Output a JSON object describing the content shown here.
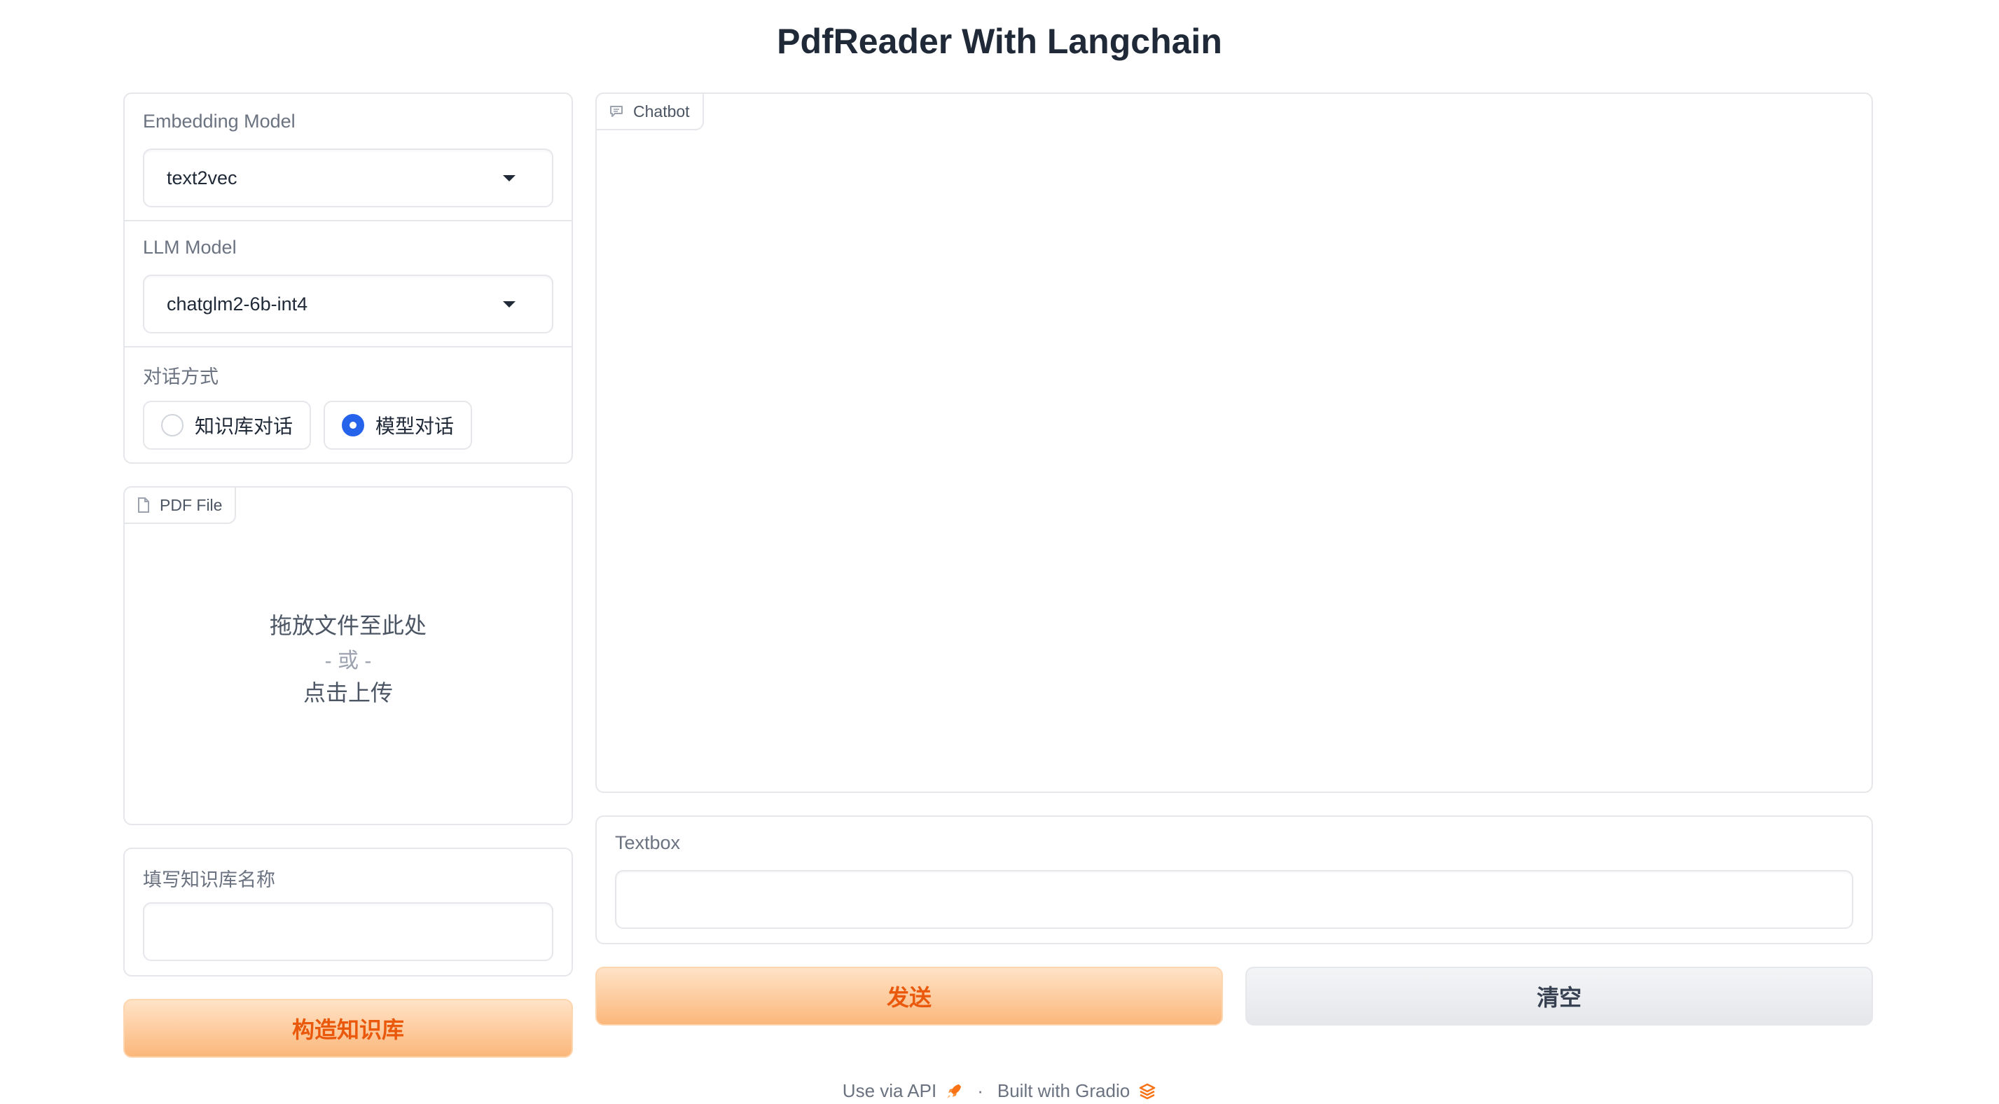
{
  "title": "PdfReader With Langchain",
  "settings": {
    "embedding": {
      "label": "Embedding Model",
      "value": "text2vec"
    },
    "llm": {
      "label": "LLM Model",
      "value": "chatglm2-6b-int4"
    },
    "mode": {
      "label": "对话方式",
      "options": [
        {
          "label": "知识库对话",
          "checked": false
        },
        {
          "label": "模型对话",
          "checked": true
        }
      ]
    }
  },
  "pdf": {
    "tag": "PDF File",
    "drop_text": "拖放文件至此处",
    "or_text": "- 或 -",
    "click_text": "点击上传"
  },
  "kb_name": {
    "label": "填写知识库名称",
    "value": ""
  },
  "build_button": "构造知识库",
  "chatbot": {
    "tag": "Chatbot"
  },
  "textbox": {
    "label": "Textbox",
    "value": ""
  },
  "send_button": "发送",
  "clear_button": "清空",
  "footer": {
    "api_link": "Use via API",
    "separator": "·",
    "built_with": "Built with Gradio"
  },
  "colors": {
    "accent": "#ea580c",
    "radio_checked": "#2563eb"
  }
}
